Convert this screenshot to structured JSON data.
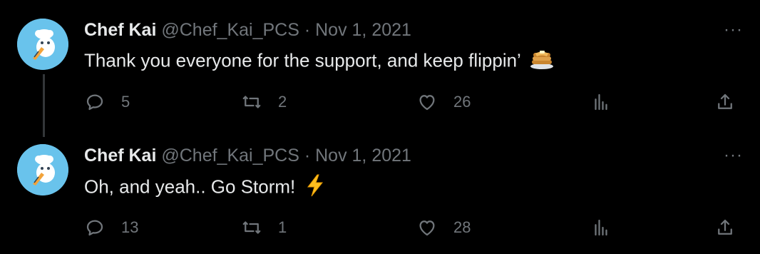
{
  "tweets": [
    {
      "name": "Chef Kai",
      "handle": "@Chef_Kai_PCS",
      "separator": "·",
      "date": "Nov 1, 2021",
      "text": "Thank you everyone for the support, and keep flippin’",
      "emoji": "pancakes-emoji",
      "replies": "5",
      "retweets": "2",
      "likes": "26"
    },
    {
      "name": "Chef Kai",
      "handle": "@Chef_Kai_PCS",
      "separator": "·",
      "date": "Nov 1, 2021",
      "text": "Oh, and yeah.. Go Storm!",
      "emoji": "lightning-emoji",
      "replies": "13",
      "retweets": "1",
      "likes": "28"
    }
  ],
  "more_label": "···",
  "colors": {
    "background": "#000000",
    "text": "#e7e9ea",
    "muted": "#71767b",
    "avatar_bg": "#69c3ec",
    "thread_line": "#333639"
  }
}
